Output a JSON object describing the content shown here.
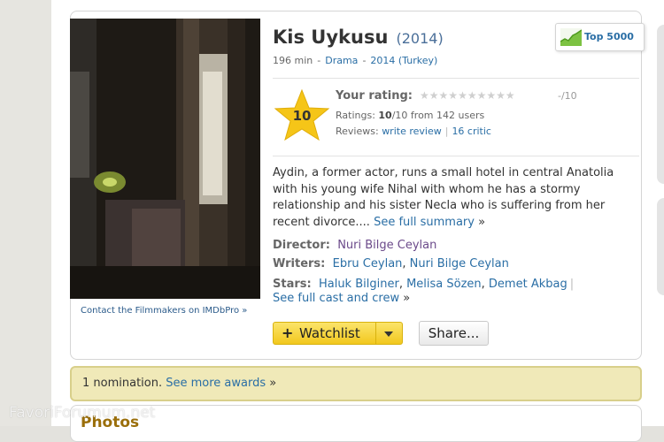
{
  "movie": {
    "title": "Kis Uykusu",
    "year": "(2014)",
    "runtime": "196 min",
    "genre": "Drama",
    "release": "2014 (Turkey)"
  },
  "badge": {
    "label": "Top 5000"
  },
  "poster": {
    "link_text": "Contact the Filmmakers on IMDbPro »"
  },
  "rating": {
    "score": "10",
    "your_rating_label": "Your rating:",
    "your_rating_value": "-/10",
    "stars_total": 10,
    "ratings_prefix": "Ratings: ",
    "ratings_value": "10",
    "ratings_suffix": "/10 from ",
    "ratings_users": "142 users",
    "reviews_prefix": "Reviews: ",
    "write_review": "write review",
    "critic": "16 critic"
  },
  "summary": {
    "text": "Aydin, a former actor, runs a small hotel in central Anatolia with his young wife Nihal with whom he has a stormy relationship and his sister Necla who is suffering from her recent divorce.... ",
    "link": "See full summary",
    "arrow": "»"
  },
  "credits": {
    "director_label": "Director:",
    "director": "Nuri Bilge Ceylan",
    "writers_label": "Writers:",
    "writer1": "Ebru Ceylan",
    "writer2": "Nuri Bilge Ceylan",
    "stars_label": "Stars:",
    "star1": "Haluk Bilginer",
    "star2": "Melisa Sözen",
    "star3": "Demet Akbag",
    "full_cast": "See full cast and crew",
    "arrow": "»"
  },
  "buttons": {
    "watchlist_plus": "+",
    "watchlist": "Watchlist",
    "share": "Share..."
  },
  "awards": {
    "text": "1 nomination. ",
    "link": "See more awards",
    "arrow": "»"
  },
  "photos": {
    "heading": "Photos"
  },
  "watermark": "FavoriForumum.net",
  "colors": {
    "link": "#2a6ea5",
    "star": "#f5c518",
    "awards_bg": "#f0e9b8",
    "watchlist": "#f2c81e"
  }
}
